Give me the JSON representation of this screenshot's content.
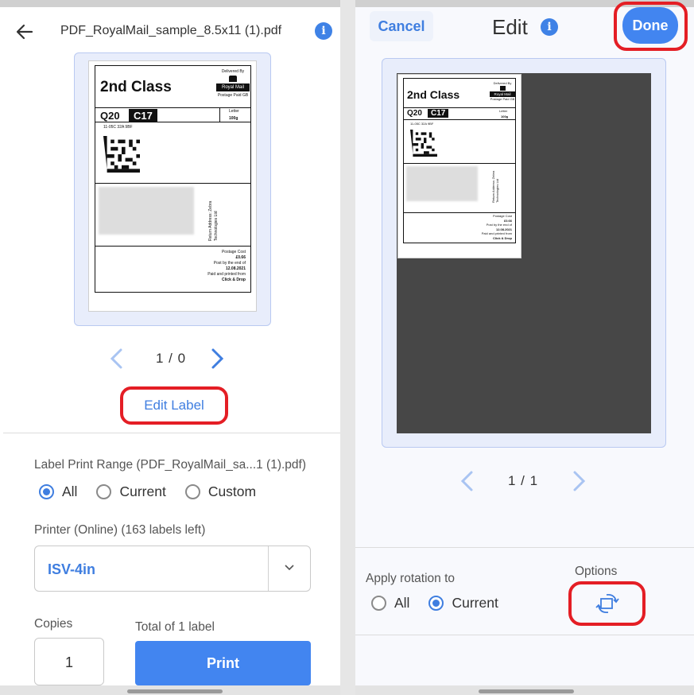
{
  "left": {
    "header": {
      "file_name": "PDF_RoyalMail_sample_8.5x11 (1).pdf"
    },
    "preview": {
      "label": {
        "service": "2nd Class",
        "code_left": "Q20",
        "code_right": "C17",
        "delivered_by": "Delivered By",
        "brand": "Royal Mail",
        "postage_paid": "Postage Paid GB",
        "letter": "Letter",
        "weight": "100g",
        "ref": "11-05C 32A 9BF",
        "return_address": "Return Address: Zebra Technologies Ltd",
        "postage_cost_label": "Postage Cost",
        "postage_cost": "£0.66",
        "post_by": "Post by the end of",
        "post_date": "12.08.2021",
        "paid_printed": "Paid and printed from",
        "click_drop": "Click & Drop"
      }
    },
    "pager": {
      "text": "1 / 0"
    },
    "edit_label": "Edit Label",
    "print_range": {
      "title": "Label Print Range (PDF_RoyalMail_sa...1 (1).pdf)",
      "options": [
        "All",
        "Current",
        "Custom"
      ],
      "selected": "All"
    },
    "printer": {
      "title": "Printer (Online) (163 labels left)",
      "selected": "ISV-4in"
    },
    "copies": {
      "label": "Copies",
      "value": "1"
    },
    "total": "Total of 1 label",
    "print_button": "Print"
  },
  "right": {
    "cancel": "Cancel",
    "title": "Edit",
    "done": "Done",
    "pager": {
      "text": "1 / 1"
    },
    "rotation": {
      "title": "Apply rotation to",
      "options": [
        "All",
        "Current"
      ],
      "selected": "Current"
    },
    "options_label": "Options"
  },
  "colors": {
    "accent": "#4285f0",
    "link": "#3f7ee0",
    "highlight": "#e41e25"
  },
  "icons": [
    "back-arrow-icon",
    "info-icon",
    "chevron-left-icon",
    "chevron-right-icon",
    "chevron-down-icon",
    "rotate-icon"
  ]
}
